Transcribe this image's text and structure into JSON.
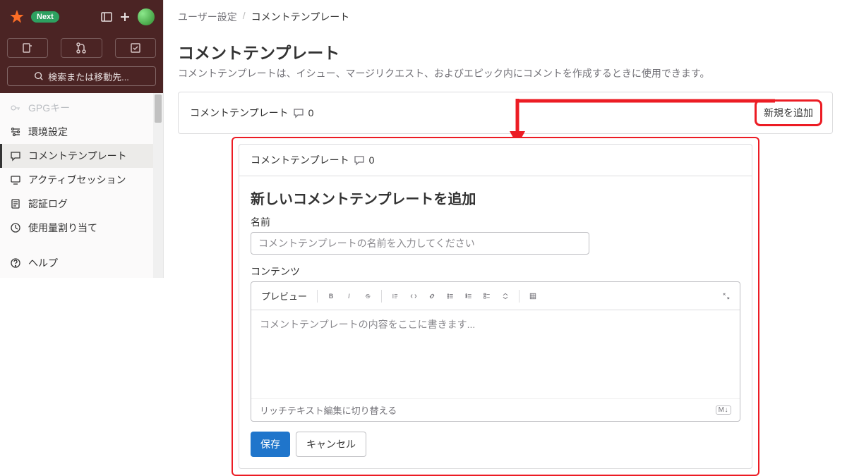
{
  "topbar": {
    "badge": "Next"
  },
  "search": {
    "label": "検索または移動先..."
  },
  "sidebar": {
    "items": [
      {
        "label": "GPGキー"
      },
      {
        "label": "環境設定"
      },
      {
        "label": "コメントテンプレート"
      },
      {
        "label": "アクティブセッション"
      },
      {
        "label": "認証ログ"
      },
      {
        "label": "使用量割り当て"
      }
    ],
    "help": "ヘルプ"
  },
  "breadcrumb": {
    "root": "ユーザー設定",
    "current": "コメントテンプレート"
  },
  "page": {
    "title": "コメントテンプレート",
    "desc": "コメントテンプレートは、イシュー、マージリクエスト、およびエピック内にコメントを作成するときに使用できます。"
  },
  "panel1": {
    "title": "コメントテンプレート",
    "count": "0",
    "add": "新規を追加"
  },
  "panel2": {
    "header_title": "コメントテンプレート",
    "header_count": "0",
    "form_title": "新しいコメントテンプレートを追加",
    "name_label": "名前",
    "name_placeholder": "コメントテンプレートの名前を入力してください",
    "content_label": "コンテンツ",
    "preview": "プレビュー",
    "content_placeholder": "コメントテンプレートの内容をここに書きます...",
    "switch_editor": "リッチテキスト編集に切り替える",
    "md_badge": "M↓",
    "save": "保存",
    "cancel": "キャンセル"
  }
}
